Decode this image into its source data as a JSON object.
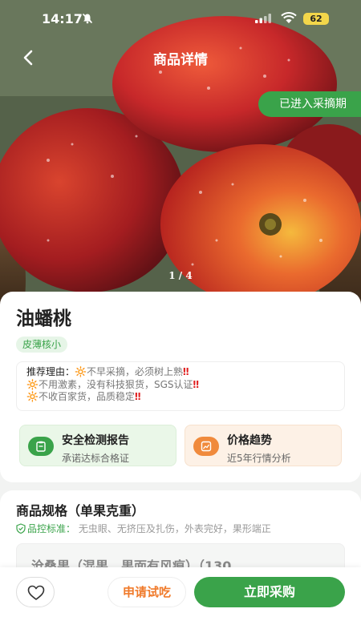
{
  "status_bar": {
    "time": "14:17",
    "battery": "62",
    "icons": [
      "bell-muted-icon",
      "signal-icon",
      "wifi-icon",
      "battery-icon"
    ]
  },
  "nav": {
    "title": "商品详情",
    "back_icon": "chevron-left-icon"
  },
  "hero": {
    "harvest_badge": "已进入采摘期",
    "pager": "1 / 4"
  },
  "product": {
    "name": "油蟠桃",
    "tag": "皮薄核小",
    "reasons_lead": "推荐理由：",
    "reasons": [
      {
        "emoji": "🔆",
        "text": "不早采摘，必须树上熟",
        "mark": "‼"
      },
      {
        "emoji": "🔆",
        "text": "不用激素，没有科技狠货，SGS认证",
        "mark": "‼"
      },
      {
        "emoji": "🔆",
        "text": "不收百家货，品质稳定",
        "mark": "‼"
      }
    ]
  },
  "features": [
    {
      "title": "安全检测报告",
      "subtitle": "承诺达标合格证",
      "icon": "report-icon"
    },
    {
      "title": "价格趋势",
      "subtitle": "近5年行情分析",
      "icon": "chart-icon"
    }
  ],
  "spec": {
    "title": "商品规格（单果克重）",
    "qc_label": "品控标准：",
    "qc_text": "无虫眼、无挤压及扎伤，外表完好，果形端正",
    "option": "沧桑果（混果、果面有风痕）（130"
  },
  "bottom": {
    "favorite_icon": "heart-icon",
    "trial": "申请试吃",
    "buy": "立即采购"
  },
  "colors": {
    "brand_green": "#3aa34a",
    "accent_orange": "#f07a2a",
    "warn_red": "#e02020"
  }
}
